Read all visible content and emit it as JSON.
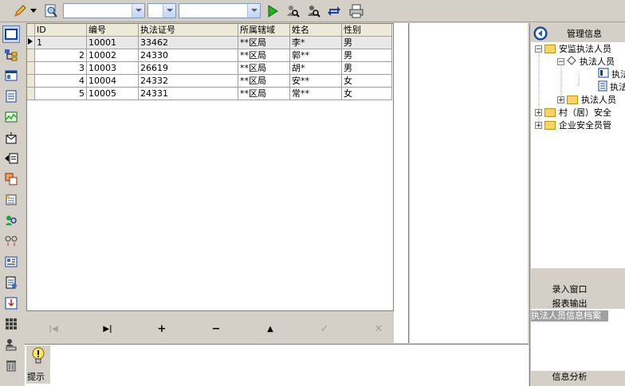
{
  "toolbar": {
    "combo1": "",
    "combo2": "",
    "combo3": ""
  },
  "grid": {
    "columns": [
      "ID",
      "编号",
      "执法证号",
      "所属辖域",
      "姓名",
      "性别"
    ],
    "rows": [
      {
        "id": "1",
        "code": "10001",
        "cert": "33462",
        "area": "**区局",
        "name": "李*",
        "sex": "男"
      },
      {
        "id": "2",
        "code": "10002",
        "cert": "24330",
        "area": "**区局",
        "name": "郭**",
        "sex": "男"
      },
      {
        "id": "3",
        "code": "10003",
        "cert": "26619",
        "area": "**区局",
        "name": "胡*",
        "sex": "男"
      },
      {
        "id": "4",
        "code": "10004",
        "cert": "24332",
        "area": "**区局",
        "name": "安**",
        "sex": "女"
      },
      {
        "id": "5",
        "code": "10005",
        "cert": "24331",
        "area": "**区局",
        "name": "常**",
        "sex": "女"
      }
    ]
  },
  "navigator": {
    "first": "|◀",
    "last": "▶|",
    "insert": "+",
    "delete": "−",
    "up": "▲",
    "post": "✓",
    "cancel": "✕"
  },
  "hint": {
    "label": "提示"
  },
  "right_panel": {
    "title": "管理信息",
    "tree": [
      "安监执法人员",
      "执法人员",
      "执法",
      "执法",
      "执法人员",
      "村（居）安全",
      "企业安全员管"
    ],
    "buttons": [
      "录入窗口",
      "报表输出"
    ],
    "list_item": "执法人员信息档案",
    "bottom_button": "信息分析"
  }
}
